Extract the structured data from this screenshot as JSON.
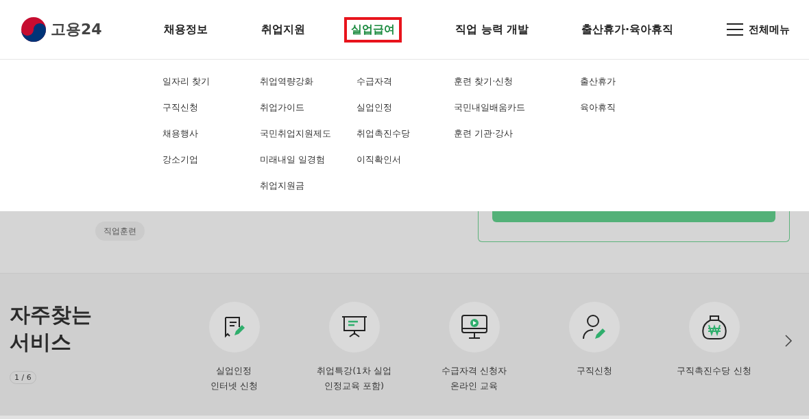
{
  "logo": {
    "text": "고용24"
  },
  "nav": [
    {
      "label": "채용정보",
      "selected": false,
      "submenu": [
        "일자리 찾기",
        "구직신청",
        "채용행사",
        "강소기업"
      ]
    },
    {
      "label": "취업지원",
      "selected": false,
      "submenu": [
        "취업역량강화",
        "취업가이드",
        "국민취업지원제도",
        "미래내일 일경험",
        "취업지원금"
      ]
    },
    {
      "label": "실업급여",
      "selected": true,
      "submenu": [
        "수급자격",
        "실업인정",
        "취업촉진수당",
        "이직확인서"
      ]
    },
    {
      "label": "직업 능력 개발",
      "selected": false,
      "submenu": [
        "훈련 찾기·신청",
        "국민내일배움카드",
        "훈련 기관·강사"
      ]
    },
    {
      "label": "출산휴가·육아휴직",
      "selected": false,
      "submenu": [
        "출산휴가",
        "육아휴직"
      ]
    }
  ],
  "all_menu": {
    "label": "전체메뉴"
  },
  "tags": [
    {
      "label": "직업훈련"
    }
  ],
  "services": {
    "title": "자주찾는\n서비스",
    "pager": "1 / 6",
    "items": [
      {
        "label": "실업인정\n인터넷 신청",
        "kind": "receipt"
      },
      {
        "label": "취업특강(1차 실업\n인정교육 포함)",
        "kind": "presentation"
      },
      {
        "label": "수급자격 신청자\n온라인 교육",
        "kind": "monitor"
      },
      {
        "label": "구직신청",
        "kind": "person"
      },
      {
        "label": "구직촉진수당 신청",
        "kind": "moneybag"
      }
    ]
  }
}
